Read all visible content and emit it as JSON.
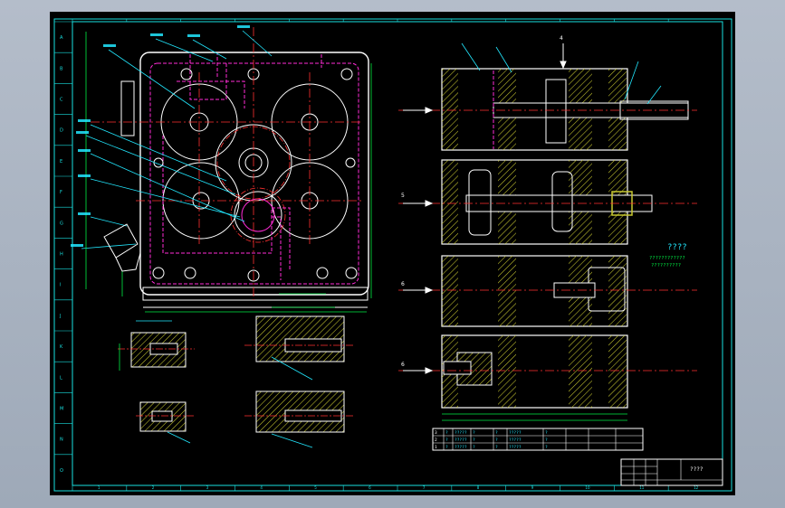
{
  "drawing": {
    "side_note_title": "????",
    "side_note_lines": [
      "????????????",
      "??????????"
    ],
    "section_marks": [
      "4",
      "5",
      "6",
      "6"
    ],
    "border_letters_left": [
      "A",
      "B",
      "C",
      "D",
      "E",
      "F",
      "G",
      "H",
      "I",
      "J",
      "K",
      "L",
      "M",
      "N",
      "O"
    ],
    "border_numbers_top": [
      "1",
      "2",
      "3",
      "4",
      "5",
      "6",
      "7",
      "8",
      "9",
      "10",
      "11",
      "12"
    ],
    "bom_rows": [
      [
        "3",
        "?",
        "?????",
        "?",
        "?",
        "?????",
        "?"
      ],
      [
        "2",
        "?",
        "?????",
        "?",
        "?",
        "?????",
        "?"
      ],
      [
        "1",
        "?",
        "?????",
        "?",
        "?",
        "?????",
        "?"
      ]
    ],
    "title_block_name": "????"
  },
  "colors": {
    "paper": "#000000",
    "frame": "#19e0e0",
    "part": "#ffffff",
    "hidden": "#ff2bd6",
    "center": "#ff3030",
    "dimension": "#00ee44",
    "hatch": "#c8c830",
    "leader": "#22e8ff"
  }
}
